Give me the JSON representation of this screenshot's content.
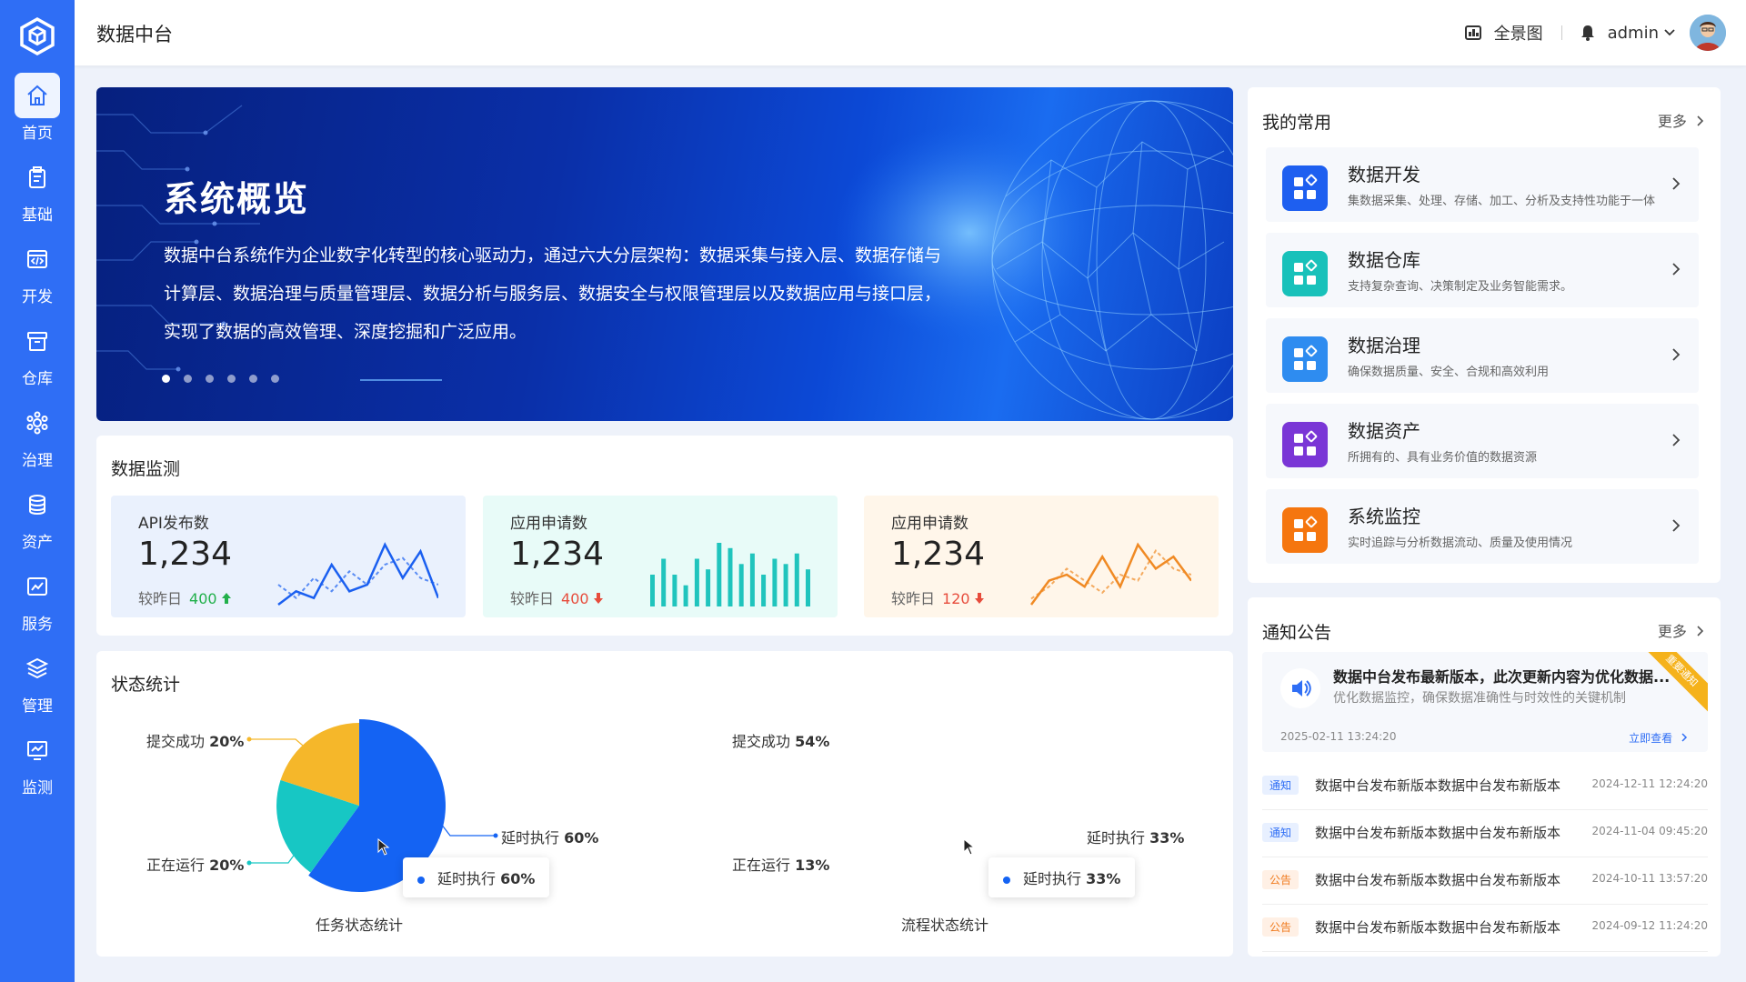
{
  "sidebar": {
    "items": [
      {
        "label": "首页",
        "icon": "home-icon",
        "active": true
      },
      {
        "label": "基础",
        "icon": "clipboard-icon"
      },
      {
        "label": "开发",
        "icon": "code-icon"
      },
      {
        "label": "仓库",
        "icon": "archive-icon"
      },
      {
        "label": "治理",
        "icon": "gear-icon"
      },
      {
        "label": "资产",
        "icon": "database-icon"
      },
      {
        "label": "服务",
        "icon": "chart-window-icon"
      },
      {
        "label": "管理",
        "icon": "layers-icon"
      },
      {
        "label": "监测",
        "icon": "monitor-icon"
      }
    ]
  },
  "header": {
    "title": "数据中台",
    "panorama_label": "全景图",
    "username": "admin"
  },
  "banner": {
    "title": "系统概览",
    "text": "数据中台系统作为企业数字化转型的核心驱动力，通过六大分层架构：数据采集与接入层、数据存储与计算层、数据治理与质量管理层、数据分析与服务层、数据安全与权限管理层以及数据应用与接口层，实现了数据的高效管理、深度挖掘和广泛应用。",
    "slide_count": 6,
    "active_slide": 1
  },
  "monitor": {
    "title": "数据监测",
    "cmp_label": "较昨日",
    "metrics": [
      {
        "label": "API发布数",
        "value": "1,234",
        "delta": "400",
        "direction": "up",
        "color": "#1a5ff0",
        "bg": "#eaf1fd",
        "spark_type": "line",
        "series_a": [
          2,
          4,
          3,
          8,
          4,
          5,
          11,
          6,
          10,
          3
        ],
        "series_b": [
          5,
          3,
          6,
          4,
          7,
          5,
          8,
          9,
          6,
          5
        ]
      },
      {
        "label": "应用申请数",
        "value": "1,234",
        "delta": "400",
        "direction": "down",
        "color": "#20c4bd",
        "bg": "#e8fbf8",
        "spark_type": "bar",
        "bars": [
          6,
          9,
          6,
          4,
          9,
          7,
          12,
          11,
          8,
          10,
          6,
          9,
          8,
          10,
          7
        ]
      },
      {
        "label": "应用申请数",
        "value": "1,234",
        "delta": "120",
        "direction": "down",
        "color": "#f08a24",
        "bg": "#fff6ea",
        "spark_type": "line",
        "series_a": [
          1,
          5,
          6,
          4,
          9,
          4,
          11,
          7,
          9,
          5
        ],
        "series_b": [
          2,
          4,
          7,
          5,
          3,
          6,
          5,
          10,
          7,
          6
        ]
      }
    ],
    "up_color": "#22b04b",
    "down_color": "#e74c3c"
  },
  "status": {
    "title": "状态统计",
    "charts": [
      {
        "title": "任务状态统计",
        "slices": [
          {
            "name": "延时执行",
            "value": 60,
            "color": "#1463f3"
          },
          {
            "name": "正在运行",
            "value": 20,
            "color": "#17c7c4"
          },
          {
            "name": "提交成功",
            "value": 20,
            "color": "#f5b72a"
          }
        ],
        "labels": [
          {
            "text": "提交成功",
            "pct": "20%"
          },
          {
            "text": "正在运行",
            "pct": "20%"
          },
          {
            "text": "延时执行",
            "pct": "60%"
          }
        ],
        "tooltip": {
          "text": "延时执行",
          "pct": "60%"
        }
      },
      {
        "title": "流程状态统计",
        "slices": [
          {
            "name": "延时执行",
            "value": 33,
            "color": "#1463f3"
          },
          {
            "name": "正在运行",
            "value": 13,
            "color": "#17c7c4"
          },
          {
            "name": "提交成功",
            "value": 54,
            "color": "#f5b72a"
          }
        ],
        "labels": [
          {
            "text": "提交成功",
            "pct": "54%"
          },
          {
            "text": "正在运行",
            "pct": "13%"
          },
          {
            "text": "延时执行",
            "pct": "33%"
          }
        ],
        "tooltip": {
          "text": "延时执行",
          "pct": "33%"
        }
      }
    ]
  },
  "chart_data": [
    {
      "type": "pie",
      "title": "任务状态统计",
      "categories": [
        "提交成功",
        "正在运行",
        "延时执行"
      ],
      "values": [
        20,
        20,
        60
      ]
    },
    {
      "type": "pie",
      "title": "流程状态统计",
      "categories": [
        "提交成功",
        "正在运行",
        "延时执行"
      ],
      "values": [
        54,
        13,
        33
      ]
    }
  ],
  "favorites": {
    "title": "我的常用",
    "more": "更多",
    "items": [
      {
        "title": "数据开发",
        "desc": "集数据采集、处理、存储、加工、分析及支持性功能于一体",
        "color": "#1e5ff0"
      },
      {
        "title": "数据仓库",
        "desc": "支持复杂查询、决策制定及业务智能需求。",
        "color": "#18c1ba"
      },
      {
        "title": "数据治理",
        "desc": "确保数据质量、安全、合规和高效利用",
        "color": "#2e8cf0"
      },
      {
        "title": "数据资产",
        "desc": "所拥有的、具有业务价值的数据资源",
        "color": "#7a36d6"
      },
      {
        "title": "系统监控",
        "desc": "实时追踪与分析数据流动、质量及使用情况",
        "color": "#f5760f"
      }
    ]
  },
  "notices": {
    "title": "通知公告",
    "more": "更多",
    "featured": {
      "title": "数据中台发布最新版本，此次更新内容为优化数据...",
      "desc": "优化数据监控，确保数据准确性与时效性的关键机制",
      "date": "2025-02-11 13:24:20",
      "action": "立即查看",
      "ribbon": "重要通知"
    },
    "rows": [
      {
        "tag": "通知",
        "tag_type": "blue",
        "text": "数据中台发布新版本数据中台发布新版本",
        "date": "2024-12-11 12:24:20"
      },
      {
        "tag": "通知",
        "tag_type": "blue",
        "text": "数据中台发布新版本数据中台发布新版本",
        "date": "2024-11-04 09:45:20"
      },
      {
        "tag": "公告",
        "tag_type": "orange",
        "text": "数据中台发布新版本数据中台发布新版本",
        "date": "2024-10-11 13:57:20"
      },
      {
        "tag": "公告",
        "tag_type": "orange",
        "text": "数据中台发布新版本数据中台发布新版本",
        "date": "2024-09-12 11:24:20"
      }
    ]
  }
}
